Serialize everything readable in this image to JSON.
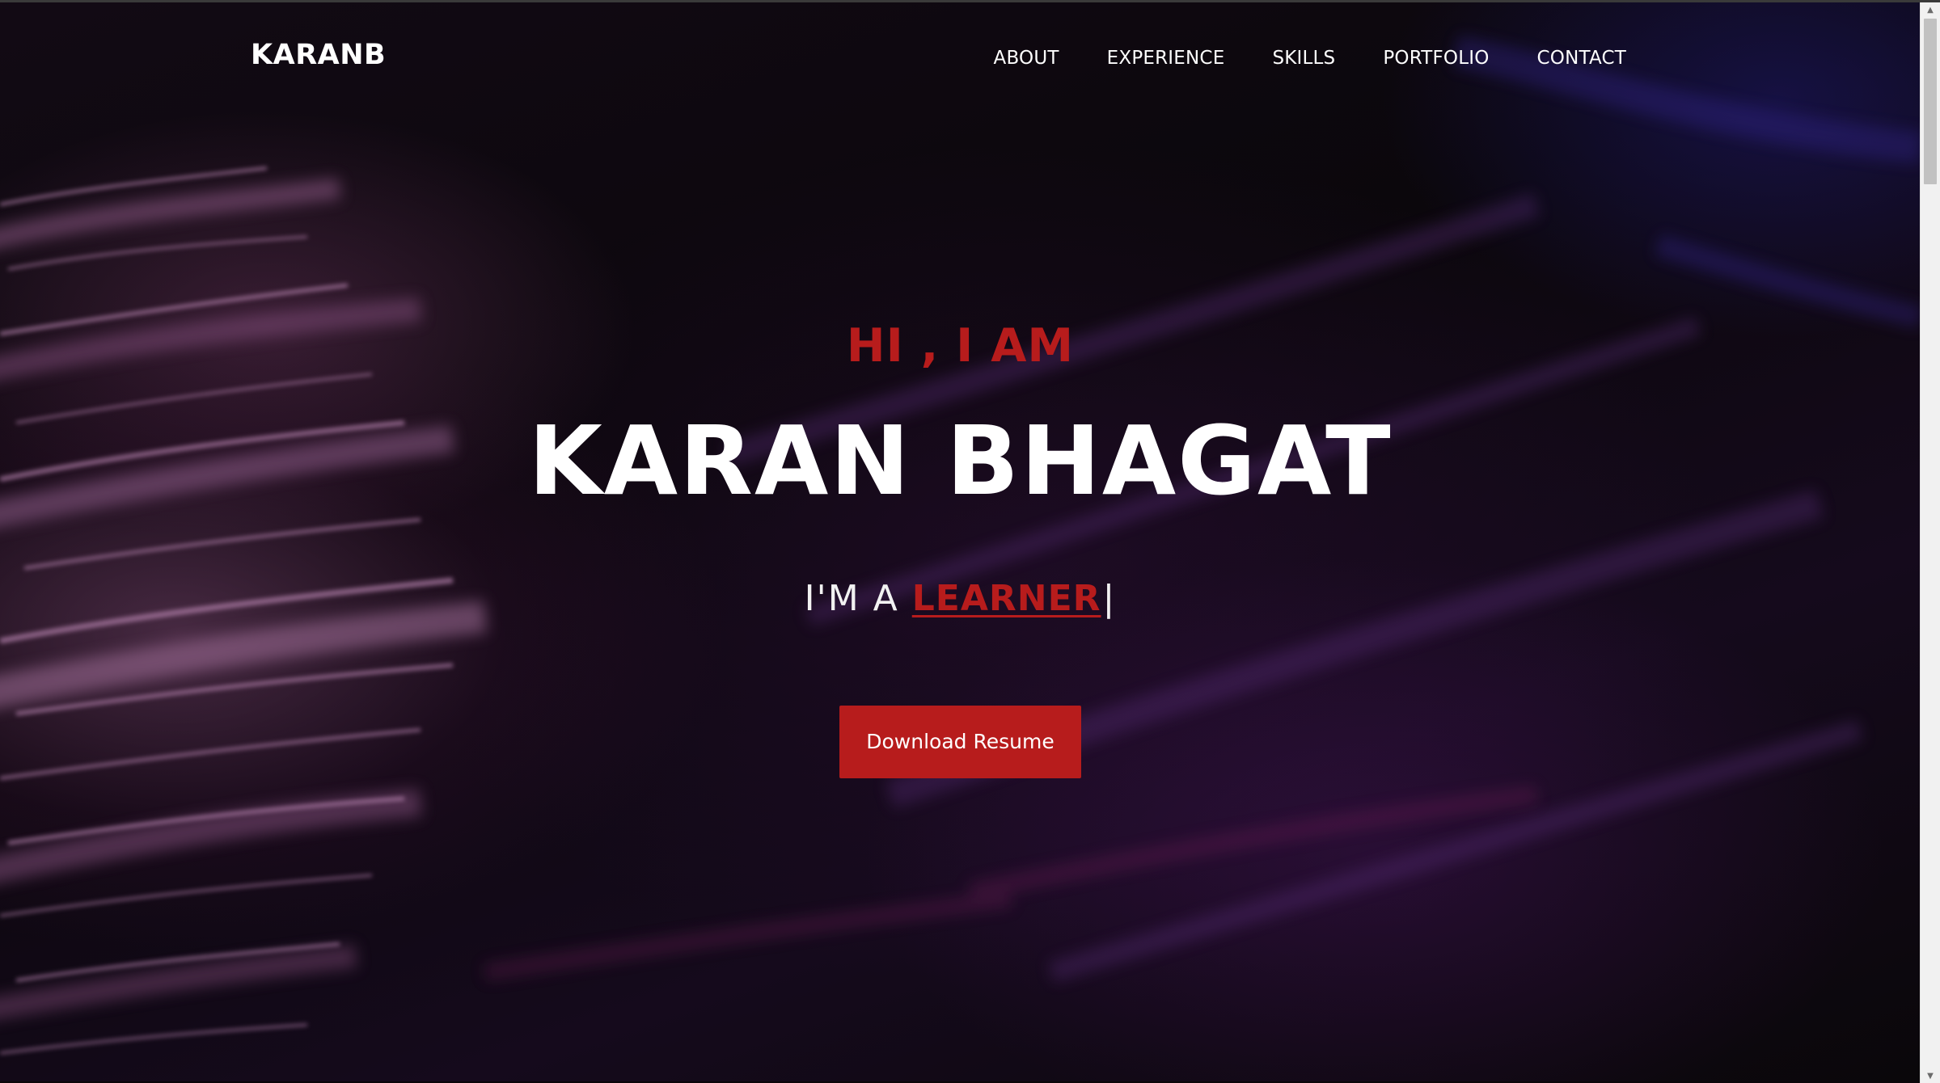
{
  "nav": {
    "brand": "KARANB",
    "items": [
      {
        "label": "ABOUT"
      },
      {
        "label": "EXPERIENCE"
      },
      {
        "label": "SKILLS"
      },
      {
        "label": "PORTFOLIO"
      },
      {
        "label": "CONTACT"
      }
    ]
  },
  "hero": {
    "greeting": "HI , I AM",
    "name": "KARAN BHAGAT",
    "role_prefix": "I'M A ",
    "role_word": "LEARNER",
    "cursor": "|",
    "button_label": "Download Resume"
  },
  "scrollbar": {
    "up_arrow": "▲",
    "down_arrow": "▼"
  },
  "colors": {
    "accent": "#b71c1c",
    "text": "#ffffff",
    "background": "#0a0609"
  }
}
